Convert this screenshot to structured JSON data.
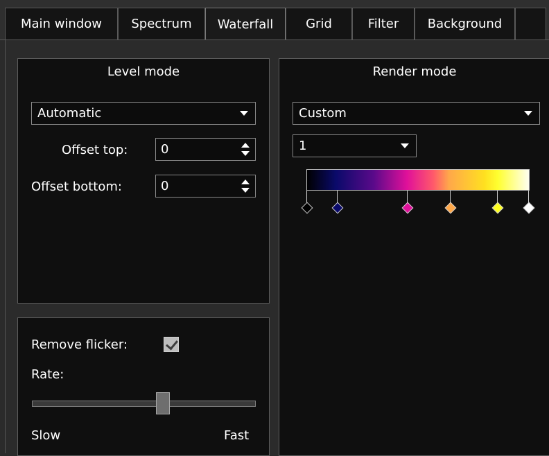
{
  "tabs": [
    {
      "label": "Main window"
    },
    {
      "label": "Spectrum"
    },
    {
      "label": "Waterfall",
      "active": true
    },
    {
      "label": "Grid"
    },
    {
      "label": "Filter"
    },
    {
      "label": "Background"
    }
  ],
  "level_mode": {
    "title": "Level mode",
    "mode_value": "Automatic",
    "offset_top_label": "Offset top:",
    "offset_top_value": "0",
    "offset_bottom_label": "Offset bottom:",
    "offset_bottom_value": "0"
  },
  "flicker": {
    "remove_flicker_label": "Remove flicker:",
    "remove_flicker_checked": true,
    "rate_label": "Rate:",
    "rate_value_fraction": 0.59,
    "slow_label": "Slow",
    "fast_label": "Fast"
  },
  "render_mode": {
    "title": "Render mode",
    "mode_value": "Custom",
    "preset_value": "1",
    "gradient_stops": [
      {
        "color": "#000000"
      },
      {
        "color": "#0a0a6a"
      },
      {
        "color": "#e0109a"
      },
      {
        "color": "#ffa84a"
      },
      {
        "color": "#ffff20"
      },
      {
        "color": "#ffffff"
      }
    ]
  }
}
